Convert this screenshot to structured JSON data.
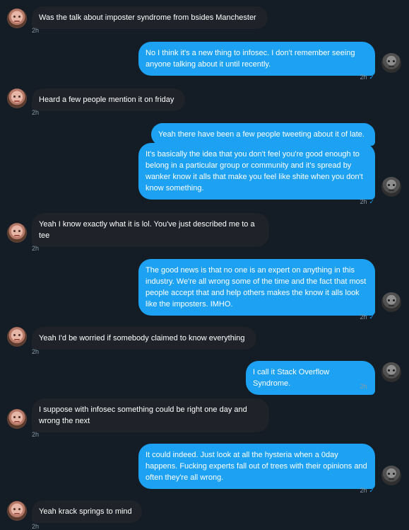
{
  "messages": [
    {
      "from": "them",
      "text": "Was the talk about imposter syndrome from bsides Manchester",
      "time": "2h"
    },
    {
      "from": "me",
      "text": "No I think it's a new thing to infosec. I don't remember seeing anyone talking about it until recently.",
      "time": "2h",
      "check": "✓"
    },
    {
      "from": "them",
      "text": "Heard a few people mention it on friday",
      "time": "2h"
    },
    {
      "from": "me",
      "text": "Yeah there have been a few people tweeting about it of late."
    },
    {
      "from": "me",
      "text": "It's basically the idea that you don't feel you're good enough to belong in a particular group or community and it's spread by wanker know it alls that make you feel like shite when you don't know something.",
      "time": "2h",
      "check": "✓"
    },
    {
      "from": "them",
      "text": "Yeah I know exactly what it is lol. You've just described me to a tee",
      "time": "2h"
    },
    {
      "from": "me",
      "text": "The good news is that no one is an expert on anything in this industry. We're all wrong some of the time and the fact that most people accept that and help others makes the know it alls look like the imposters. IMHO.",
      "time": "2h",
      "check": "✓"
    },
    {
      "from": "them",
      "text": "Yeah I'd be worried if somebody claimed to know everything",
      "time": "2h"
    },
    {
      "from": "me",
      "text": "I call it Stack Overflow Syndrome.",
      "time": "2h",
      "check": "✓"
    },
    {
      "from": "them",
      "text": "I suppose with infosec something could be right one day and wrong the next",
      "time": "2h"
    },
    {
      "from": "me",
      "text": "It could indeed. Just look at all the hysteria when a 0day happens. Fucking experts fall out of trees with their opinions and often they're all wrong.",
      "time": "2h",
      "check": "✓"
    },
    {
      "from": "them",
      "text": "Yeah krack springs to mind",
      "time": "2h"
    }
  ],
  "colors": {
    "background": "#141d26",
    "incoming_bubble": "#1f2228",
    "outgoing_bubble": "#1da1f2",
    "meta_text": "#8899a6"
  }
}
